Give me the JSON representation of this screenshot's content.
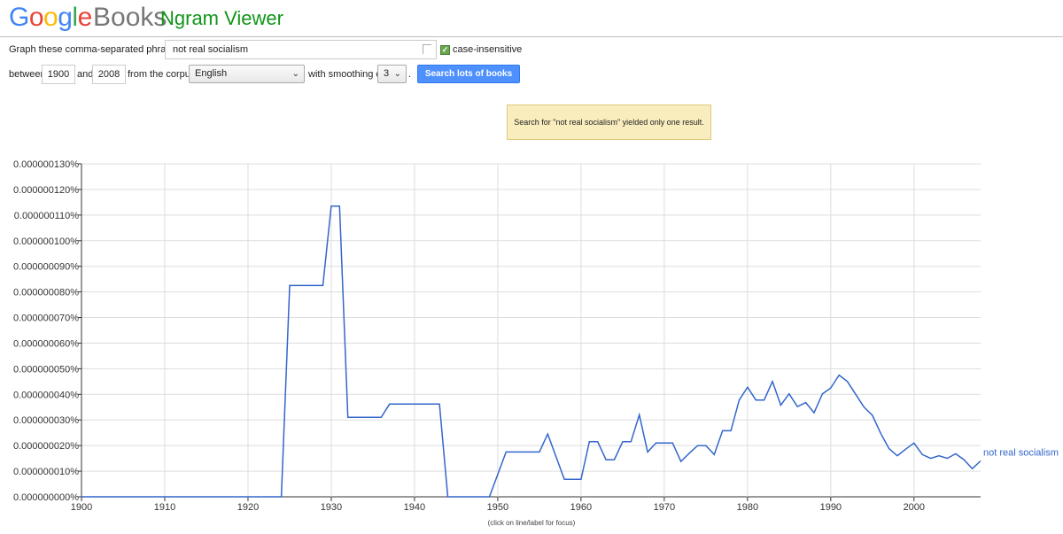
{
  "header": {
    "logo_letters": [
      {
        "char": "G",
        "color": "#4285F4"
      },
      {
        "char": "o",
        "color": "#EA4335"
      },
      {
        "char": "o",
        "color": "#FBBC05"
      },
      {
        "char": "g",
        "color": "#4285F4"
      },
      {
        "char": "l",
        "color": "#34A853"
      },
      {
        "char": "e",
        "color": "#EA4335"
      }
    ],
    "books_label": "Books",
    "app_title": "Ngram Viewer"
  },
  "form": {
    "phrases_label": "Graph these comma-separated phrases:",
    "phrase_value": "not real socialism",
    "case_insensitive_label": "case-insensitive",
    "case_insensitive_checked": true,
    "between_label": "between",
    "start_year": "1900",
    "and_label": "and",
    "end_year": "2008",
    "corpus_label": "from the corpus",
    "corpus_value": "English",
    "smoothing_label": "with smoothing of",
    "smoothing_value": "3",
    "period": ".",
    "search_button_label": "Search lots of books"
  },
  "notice": {
    "text": "Search for \"not real socialism\" yielded only one result."
  },
  "footer_note": "(click on line/label for focus)",
  "chart_data": {
    "type": "line",
    "x_ticks": [
      1900,
      1910,
      1920,
      1930,
      1940,
      1950,
      1960,
      1970,
      1980,
      1990,
      2000
    ],
    "y_ticks": [
      "0.000000000%",
      "0.000000010%",
      "0.000000020%",
      "0.000000030%",
      "0.000000040%",
      "0.000000050%",
      "0.000000060%",
      "0.000000070%",
      "0.000000080%",
      "0.000000090%",
      "0.000000100%",
      "0.000000110%",
      "0.000000120%",
      "0.000000130%"
    ],
    "xlim": [
      1900,
      2008
    ],
    "ylim": [
      0,
      1.3e-07
    ],
    "grid": true,
    "line_color": "#3366cc",
    "series": [
      {
        "name": "not real socialism",
        "x": [
          1900,
          1924,
          1925,
          1929,
          1930,
          1931,
          1932,
          1936,
          1937,
          1943,
          1944,
          1949,
          1951,
          1955,
          1956,
          1958,
          1960,
          1961,
          1962,
          1963,
          1964,
          1965,
          1966,
          1967,
          1968,
          1969,
          1970,
          1971,
          1972,
          1973,
          1974,
          1975,
          1976,
          1977,
          1978,
          1979,
          1980,
          1981,
          1982,
          1983,
          1984,
          1985,
          1986,
          1987,
          1988,
          1989,
          1990,
          1991,
          1992,
          1993,
          1994,
          1995,
          1996,
          1997,
          1998,
          1999,
          2000,
          2001,
          2002,
          2003,
          2004,
          2005,
          2006,
          2007,
          2008
        ],
        "values": [
          0,
          0,
          8.25e-08,
          8.25e-08,
          1.135e-07,
          1.135e-07,
          3.1e-08,
          3.1e-08,
          3.62e-08,
          3.62e-08,
          0,
          0,
          1.75e-08,
          1.75e-08,
          2.45e-08,
          6.8e-09,
          6.8e-09,
          2.15e-08,
          2.15e-08,
          1.45e-08,
          1.45e-08,
          2.15e-08,
          2.15e-08,
          3.2e-08,
          1.75e-08,
          2.1e-08,
          2.1e-08,
          2.1e-08,
          1.38e-08,
          1.7e-08,
          2e-08,
          2e-08,
          1.65e-08,
          2.58e-08,
          2.58e-08,
          3.78e-08,
          4.28e-08,
          3.78e-08,
          3.78e-08,
          4.5e-08,
          3.58e-08,
          4.02e-08,
          3.52e-08,
          3.68e-08,
          3.28e-08,
          4.02e-08,
          4.25e-08,
          4.75e-08,
          4.5e-08,
          4e-08,
          3.5e-08,
          3.18e-08,
          2.48e-08,
          1.88e-08,
          1.6e-08,
          1.86e-08,
          2.1e-08,
          1.65e-08,
          1.5e-08,
          1.6e-08,
          1.5e-08,
          1.68e-08,
          1.45e-08,
          1.1e-08,
          1.4e-08
        ]
      }
    ]
  }
}
